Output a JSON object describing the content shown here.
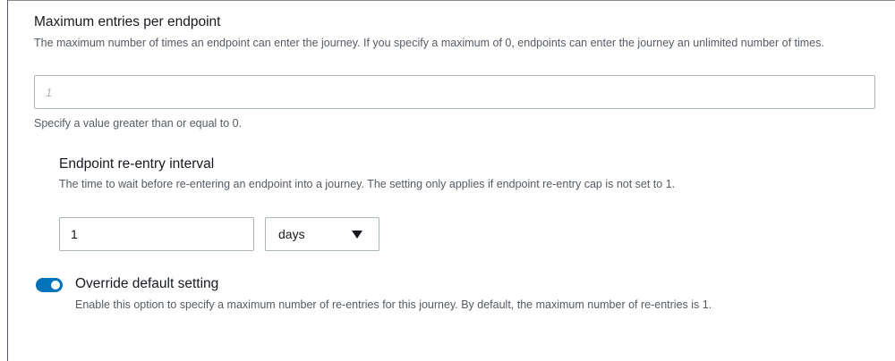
{
  "max_entries": {
    "label": "Maximum entries per endpoint",
    "description": "The maximum number of times an endpoint can enter the journey. If you specify a maximum of 0, endpoints can enter the journey an unlimited number of times.",
    "placeholder": "1",
    "value": "",
    "hint": "Specify a value greater than or equal to 0."
  },
  "reentry_interval": {
    "label": "Endpoint re-entry interval",
    "description": "The time to wait before re-entering an endpoint into a journey. The setting only applies if endpoint re-entry cap is not set to 1.",
    "value": "1",
    "unit": "days"
  },
  "override": {
    "label": "Override default setting",
    "description": "Enable this option to specify a maximum number of re-entries for this journey. By default, the maximum number of re-entries is 1.",
    "enabled": true
  },
  "colors": {
    "toggle_on": "#0073bb",
    "text_primary": "#16191f",
    "text_secondary": "#545b64",
    "input_border": "#aab7b8"
  }
}
